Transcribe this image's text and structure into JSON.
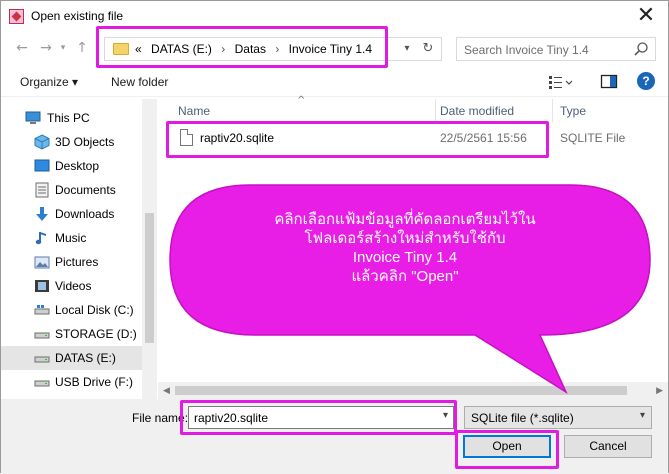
{
  "window": {
    "title": "Open existing file",
    "close_glyph": "✕"
  },
  "nav": {
    "back_glyph": "←",
    "forward_glyph": "→",
    "up_glyph": "↑",
    "recent_glyph": "▾",
    "crumbs": [
      "«",
      "DATAS (E:)",
      "›",
      "Datas",
      "›",
      "Invoice Tiny 1.4"
    ],
    "dropdown_glyph": "▾",
    "refresh_glyph": "↻",
    "search_placeholder": "Search Invoice Tiny 1.4"
  },
  "toolbar": {
    "organize_label": "Organize ▾",
    "new_folder_label": "New folder",
    "help_glyph": "?"
  },
  "sidebar": {
    "items": [
      {
        "label": "This PC",
        "icon": "pc-icon"
      },
      {
        "label": "3D Objects",
        "icon": "cube-icon"
      },
      {
        "label": "Desktop",
        "icon": "desktop-icon"
      },
      {
        "label": "Documents",
        "icon": "documents-icon"
      },
      {
        "label": "Downloads",
        "icon": "download-icon"
      },
      {
        "label": "Music",
        "icon": "music-icon"
      },
      {
        "label": "Pictures",
        "icon": "pictures-icon"
      },
      {
        "label": "Videos",
        "icon": "videos-icon"
      },
      {
        "label": "Local Disk (C:)",
        "icon": "drive-icon"
      },
      {
        "label": "STORAGE (D:)",
        "icon": "drive-icon"
      },
      {
        "label": "DATAS (E:)",
        "icon": "drive-icon"
      },
      {
        "label": "USB Drive (F:)",
        "icon": "usb-drive-icon"
      }
    ],
    "selected_index": 10
  },
  "filelist": {
    "columns": {
      "name": "Name",
      "date": "Date modified",
      "type": "Type"
    },
    "sort_glyph": "^",
    "scroll_left": "◀",
    "scroll_right": "▶",
    "files": [
      {
        "name": "raptiv20.sqlite",
        "date": "22/5/2561 15:56",
        "type": "SQLITE File"
      }
    ]
  },
  "bottom": {
    "filename_label": "File name:",
    "filename_value": "raptiv20.sqlite",
    "filetype_value": "SQLite file (*.sqlite)",
    "caret": "▾",
    "open_label": "Open",
    "cancel_label": "Cancel"
  },
  "callout": {
    "lines": [
      "คลิกเลือกแฟ้มข้อมูลที่คัดลอกเตรียมไว้ใน",
      "โฟลเดอร์สร้างใหม่สำหรับใช้กับ",
      "Invoice Tiny 1.4",
      "แล้วคลิก \"Open\""
    ],
    "color": "#e91ee6"
  },
  "colors": {
    "highlight": "#e21be3",
    "accent": "#0078d7",
    "help": "#1a66b8"
  }
}
